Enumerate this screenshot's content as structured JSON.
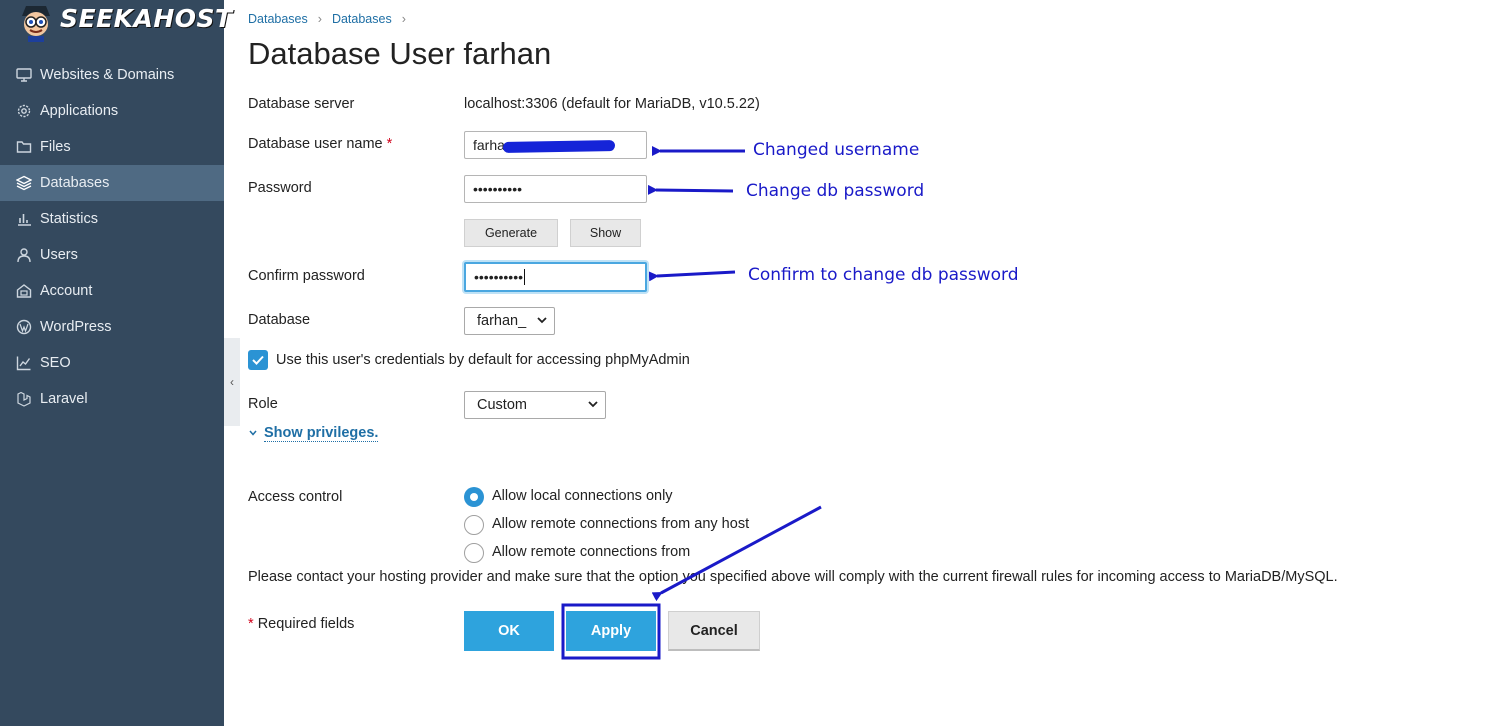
{
  "brand": {
    "logo_text": "SEEKAHOST"
  },
  "sidebar": {
    "items": [
      {
        "label": "Websites & Domains",
        "icon": "monitor-icon",
        "active": false
      },
      {
        "label": "Applications",
        "icon": "gear-icon",
        "active": false
      },
      {
        "label": "Files",
        "icon": "folder-icon",
        "active": false
      },
      {
        "label": "Databases",
        "icon": "layers-icon",
        "active": true
      },
      {
        "label": "Statistics",
        "icon": "bar-chart-icon",
        "active": false
      },
      {
        "label": "Users",
        "icon": "user-icon",
        "active": false
      },
      {
        "label": "Account",
        "icon": "account-icon",
        "active": false
      },
      {
        "label": "WordPress",
        "icon": "wordpress-icon",
        "active": false
      },
      {
        "label": "SEO",
        "icon": "seo-chart-icon",
        "active": false
      },
      {
        "label": "Laravel",
        "icon": "laravel-icon",
        "active": false
      }
    ]
  },
  "breadcrumb": [
    "Databases",
    "Databases"
  ],
  "page_title": "Database User farhan",
  "form": {
    "db_server_label": "Database server",
    "db_server_value": "localhost:3306 (default for MariaDB, v10.5.22)",
    "username_label": "Database user name",
    "required_marker": "*",
    "username_value": "farha",
    "password_label": "Password",
    "password_value": "••••••••••",
    "generate_label": "Generate",
    "show_label": "Show",
    "confirm_label": "Confirm password",
    "confirm_value": "••••••••••",
    "database_label": "Database",
    "database_value": "farhan_",
    "phpmyadmin_label": "Use this user's credentials by default for accessing phpMyAdmin",
    "phpmyadmin_checked": true,
    "role_label": "Role",
    "role_value": "Custom",
    "show_privileges": "Show privileges.",
    "access_label": "Access control",
    "access_options": [
      {
        "label": "Allow local connections only",
        "checked": true
      },
      {
        "label": "Allow remote connections from any host",
        "checked": false
      },
      {
        "label": "Allow remote connections from",
        "checked": false
      }
    ],
    "note": "Please contact your hosting provider and make sure that the option you specified above will comply with the current firewall rules for incoming access to MariaDB/MySQL.",
    "required_fields": "Required fields"
  },
  "buttons": {
    "ok": "OK",
    "apply": "Apply",
    "cancel": "Cancel"
  },
  "annotations": {
    "username": "Changed username",
    "password": "Change db password",
    "confirm": "Confirm to change db password"
  },
  "colors": {
    "sidebar_bg": "#34495e",
    "sidebar_active": "#4f6a83",
    "accent": "#2ea3dd",
    "annotation": "#1a1ac8",
    "link": "#1f6fa5"
  }
}
